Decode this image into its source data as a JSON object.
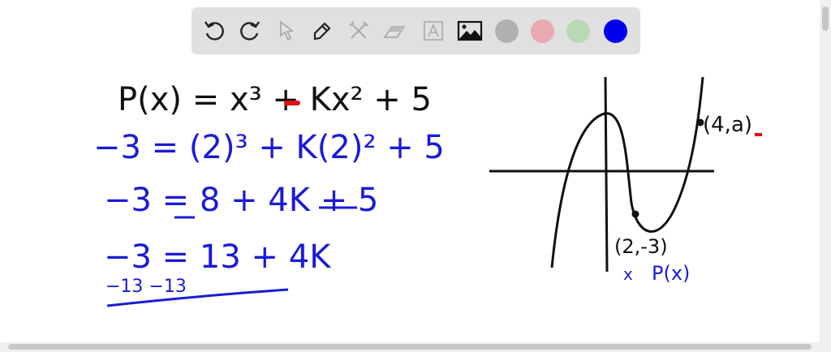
{
  "toolbar": {
    "tools": [
      "undo-icon",
      "redo-icon",
      "select-icon",
      "pen-icon",
      "tools-icon",
      "eraser-icon",
      "text-icon",
      "image-icon"
    ],
    "colors": [
      "#b0b0b0",
      "#e8a9b0",
      "#b9d8b5",
      "#0000ee"
    ],
    "selected_color": "#0000ee"
  },
  "board": {
    "ink_black": "#111111",
    "ink_blue": "#1a1ad6",
    "ink_red": "#e01010",
    "lines": [
      {
        "text": "P(x) = x³ + Kx² + 5",
        "color": "black"
      },
      {
        "text": "−3 = (2)³ + K(2)² + 5",
        "color": "blue"
      },
      {
        "text": "−3 = 8  + 4K  + 5",
        "color": "blue"
      },
      {
        "text": "−3 = 13 + 4K",
        "color": "blue"
      },
      {
        "text": "−13    −13",
        "color": "blue"
      }
    ],
    "graph": {
      "point_top_label": "(4,a)",
      "point_bottom_label": "(2,-3)",
      "axis_x_label": "x",
      "axis_y_label": "P(x)"
    }
  }
}
